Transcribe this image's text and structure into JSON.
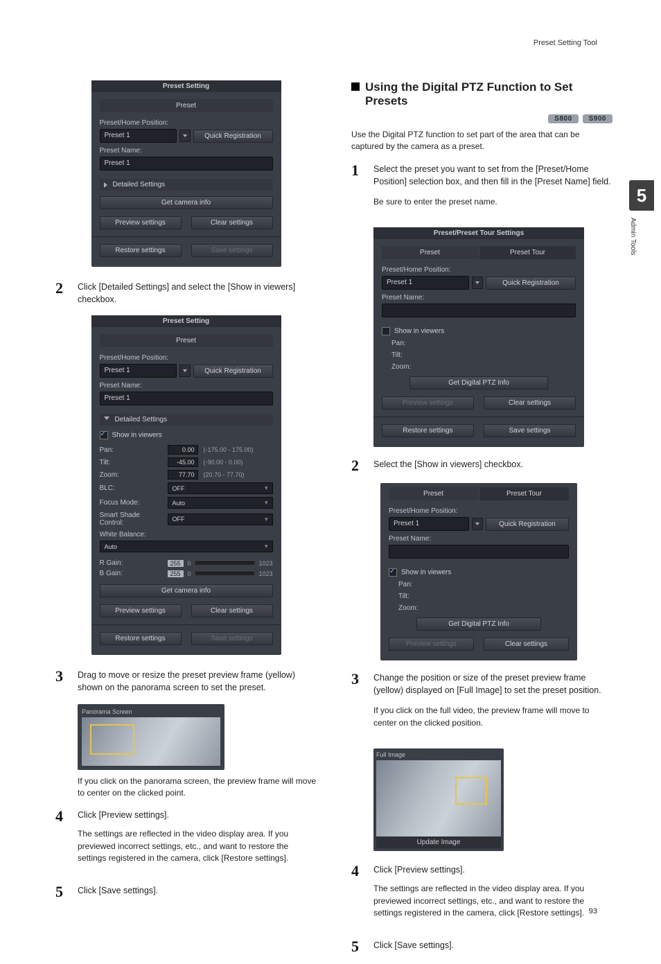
{
  "header": {
    "tool_name": "Preset Setting Tool"
  },
  "chapter": {
    "num": "5",
    "side_label": "Admin Tools"
  },
  "page_number": "93",
  "left": {
    "panel1": {
      "title": "Preset Setting",
      "tab": "Preset",
      "preset_home_label": "Preset/Home Position:",
      "preset_value": "Preset 1",
      "quick_reg": "Quick Registration",
      "preset_name_label": "Preset Name:",
      "preset_name_value": "Preset 1",
      "detailed": "Detailed Settings",
      "get_cam": "Get camera info",
      "preview": "Preview settings",
      "clear": "Clear settings",
      "restore": "Restore settings",
      "save": "Save settings"
    },
    "step2": "Click [Detailed Settings] and select the [Show in viewers] checkbox.",
    "panel2": {
      "title": "Preset Setting",
      "tab": "Preset",
      "preset_home_label": "Preset/Home Position:",
      "preset_value": "Preset 1",
      "quick_reg": "Quick Registration",
      "preset_name_label": "Preset Name:",
      "preset_name_value": "Preset 1",
      "detailed": "Detailed Settings",
      "show_label": "Show in viewers",
      "pan": {
        "label": "Pan:",
        "value": "0.00",
        "range": "(-175.00 - 175.00)"
      },
      "tilt": {
        "label": "Tilt:",
        "value": "-45.00",
        "range": "(-90.00 - 0.00)"
      },
      "zoom": {
        "label": "Zoom:",
        "value": "77.70",
        "range": "(20.70 - 77.70)"
      },
      "blc": {
        "label": "BLC:",
        "value": "OFF"
      },
      "focus": {
        "label": "Focus Mode:",
        "value": "Auto"
      },
      "ssc": {
        "label": "Smart Shade Control:",
        "value": "OFF"
      },
      "wb_label": "White Balance:",
      "wb_value": "Auto",
      "r_gain": {
        "label": "R Gain:",
        "value": "255",
        "min": "0",
        "max": "1023"
      },
      "b_gain": {
        "label": "B Gain:",
        "value": "255",
        "min": "0",
        "max": "1023"
      },
      "get_cam": "Get camera info",
      "preview": "Preview settings",
      "clear": "Clear settings",
      "restore": "Restore settings",
      "save": "Save settings"
    },
    "step3": "Drag to move or resize the preset preview frame (yellow) shown on the panorama screen to set the preset.",
    "pano_caption": "Panorama Screen",
    "after_pano": "If you click on the panorama screen, the preview frame will move to center on the clicked point.",
    "step4_head": "Click [Preview settings].",
    "step4_body": "The settings are reflected in the video display area. If you previewed incorrect settings, etc., and want to restore the settings registered in the camera, click [Restore settings].",
    "step5": "Click [Save settings]."
  },
  "right": {
    "heading": "Using the Digital PTZ Function to Set Presets",
    "pills": [
      "S800",
      "S900"
    ],
    "intro": "Use the Digital PTZ function to set part of the area that can be captured by the camera as a preset.",
    "step1_head": "Select the preset you want to set from the [Preset/Home Position] selection box, and then fill in the [Preset Name] field.",
    "step1_body": "Be sure to enter the preset name.",
    "panel1": {
      "title": "Preset/Preset Tour Settings",
      "tab_preset": "Preset",
      "tab_tour": "Preset Tour",
      "preset_home_label": "Preset/Home Position:",
      "preset_value": "Preset 1",
      "quick_reg": "Quick Registration",
      "preset_name_label": "Preset Name:",
      "show_label": "Show in viewers",
      "pan": "Pan:",
      "tilt": "Tilt:",
      "zoom": "Zoom:",
      "get_dptz": "Get Digital PTZ Info",
      "preview": "Preview settings",
      "clear": "Clear settings",
      "restore": "Restore settings",
      "save": "Save settings"
    },
    "step2": "Select the [Show in viewers] checkbox.",
    "panel2": {
      "tab_preset": "Preset",
      "tab_tour": "Preset Tour",
      "preset_home_label": "Preset/Home Position:",
      "preset_value": "Preset 1",
      "quick_reg": "Quick Registration",
      "preset_name_label": "Preset Name:",
      "show_label": "Show in viewers",
      "pan": "Pan:",
      "tilt": "Tilt:",
      "zoom": "Zoom:",
      "get_dptz": "Get Digital PTZ Info",
      "preview": "Preview settings",
      "clear": "Clear settings"
    },
    "step3": "Change the position or size of the preset preview frame (yellow) displayed on [Full Image] to set the preset position.",
    "step3_body": "If you click on the full video, the preview frame will move to center on the clicked position.",
    "full_image_caption": "Full Image",
    "update_image": "Update Image",
    "step4_head": "Click [Preview settings].",
    "step4_body": "The settings are reflected in the video display area. If you previewed incorrect settings, etc., and want to restore the settings registered in the camera, click [Restore settings].",
    "step5": "Click [Save settings]."
  }
}
